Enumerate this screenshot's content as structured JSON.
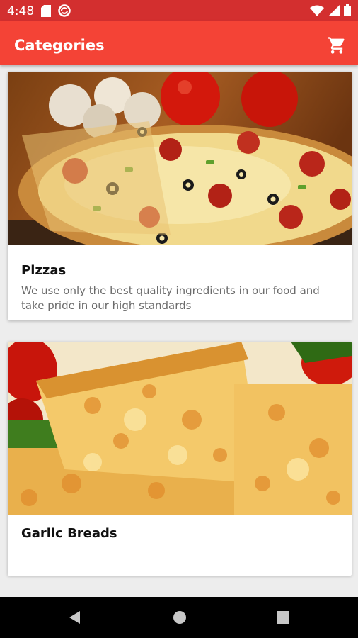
{
  "status_bar": {
    "time": "4:48",
    "left_icons": [
      "sd-card-icon",
      "sync-circle-icon"
    ],
    "right_icons": [
      "wifi-icon",
      "signal-icon",
      "battery-icon"
    ]
  },
  "app_bar": {
    "title": "Categories",
    "action_icon": "shopping-cart-icon"
  },
  "categories": [
    {
      "title": "Pizzas",
      "description": "We use only the best quality ingredients in our food and take pride in our high standards",
      "image": "pepperoni-pizza-image"
    },
    {
      "title": "Garlic Breads",
      "description": "",
      "image": "cheese-pizza-slice-image"
    }
  ],
  "nav_bar": {
    "buttons": [
      "back-icon",
      "home-icon",
      "recents-icon"
    ]
  },
  "colors": {
    "status_bar": "#d32f2f",
    "app_bar": "#f44336",
    "background": "#ededed"
  }
}
